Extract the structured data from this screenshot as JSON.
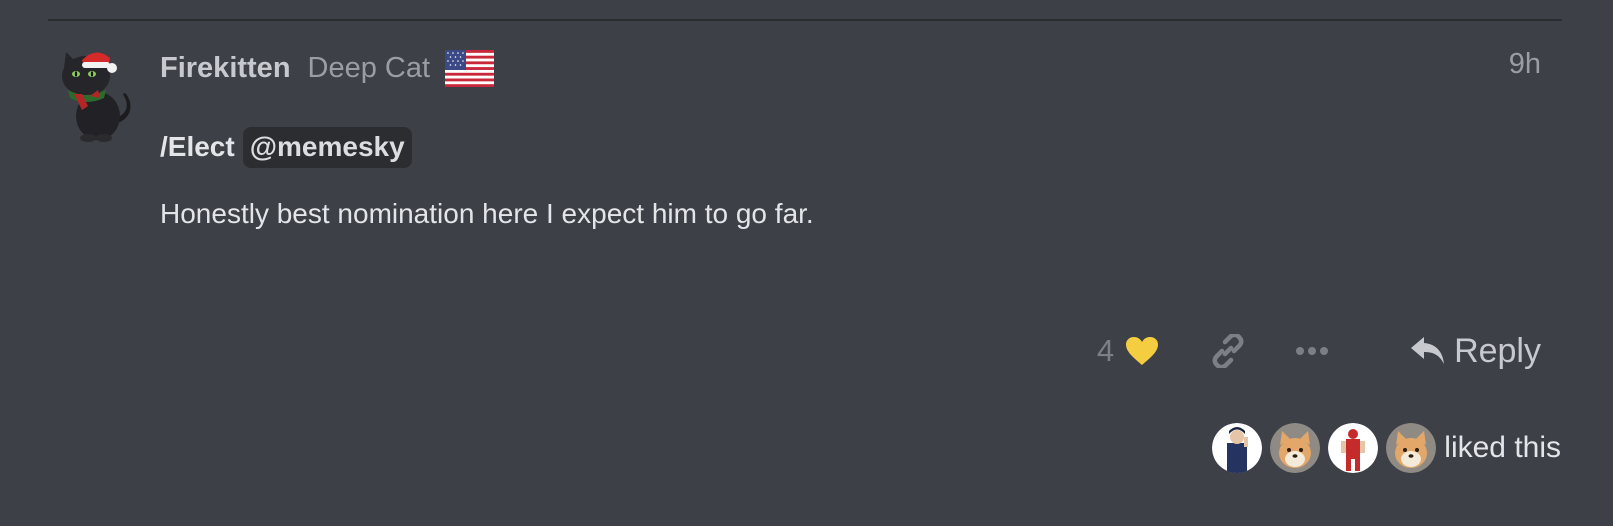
{
  "post": {
    "username": "Firekitten",
    "user_title": "Deep Cat",
    "flag_icon": "us-flag-icon",
    "date": "9h",
    "command": "/Elect",
    "mention": "@memesky",
    "body": "Honestly best nomination here I expect him to go far."
  },
  "actions": {
    "like_count": "4",
    "heart_icon": "heart-icon",
    "heart_color": "#f5cd40",
    "link_icon": "link-icon",
    "more_icon": "ellipsis-icon",
    "reply_icon": "reply-arrow-icon",
    "reply_label": "Reply"
  },
  "likers": {
    "avatars": [
      "businessman-avatar",
      "shiba-avatar",
      "red-figure-avatar",
      "shiba-avatar"
    ],
    "label": "liked this"
  },
  "colors": {
    "background": "#3d4047",
    "text": "#e4e5e8",
    "muted": "#9a9da4",
    "mention_bg": "#2b2d31"
  }
}
